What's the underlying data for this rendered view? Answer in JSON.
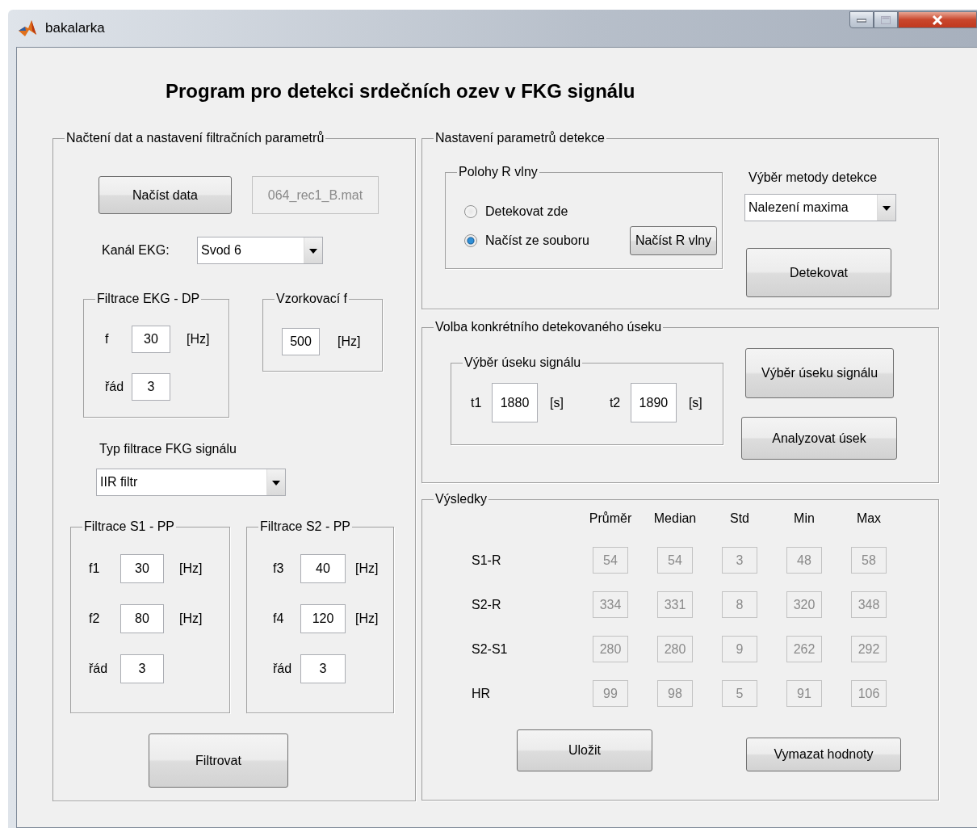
{
  "window": {
    "title": "bakalarka"
  },
  "heading": "Program pro detekci srdečních ozev v FKG signálu",
  "load_panel": {
    "title": "Načtení dat a nastavení filtračních parametrů",
    "load_button": "Načíst data",
    "file_field": {
      "value": "064_rec1_B.mat",
      "disabled": true
    },
    "channel_label": "Kanál EKG:",
    "channel_select": "Svod 6",
    "ekg_filter": {
      "title": "Filtrace EKG - DP",
      "rows": [
        {
          "label": "f",
          "value": "30",
          "unit": "[Hz]"
        },
        {
          "label": "řád",
          "value": "3"
        }
      ]
    },
    "sampling": {
      "title": "Vzorkovací f",
      "value": "500",
      "unit": "[Hz]"
    },
    "filter_type_label": "Typ filtrace FKG signálu",
    "filter_type_select": "IIR filtr",
    "s1_filter": {
      "title": "Filtrace S1 - PP",
      "rows": [
        {
          "label": "f1",
          "value": "30",
          "unit": "[Hz]"
        },
        {
          "label": "f2",
          "value": "80",
          "unit": "[Hz]"
        },
        {
          "label": "řád",
          "value": "3"
        }
      ]
    },
    "s2_filter": {
      "title": "Filtrace S2 - PP",
      "rows": [
        {
          "label": "f3",
          "value": "40",
          "unit": "[Hz]"
        },
        {
          "label": "f4",
          "value": "120",
          "unit": "[Hz]"
        },
        {
          "label": "řád",
          "value": "3"
        }
      ]
    },
    "filter_button": "Filtrovat"
  },
  "detection_panel": {
    "title": "Nastavení parametrů detekce",
    "r_wave": {
      "title": "Polohy R vlny",
      "options": [
        {
          "label": "Detekovat zde",
          "selected": false
        },
        {
          "label": "Načíst ze souboru",
          "selected": true
        }
      ],
      "load_button": "Načíst R vlny"
    },
    "method_label": "Výběr metody detekce",
    "method_select": "Nalezení maxima",
    "detect_button": "Detekovat"
  },
  "segment_panel": {
    "title": "Volba konkrétního detekovaného úseku",
    "range": {
      "title": "Výběr úseku signálu",
      "fields": [
        {
          "label": "t1",
          "value": "1880",
          "unit": "[s]"
        },
        {
          "label": "t2",
          "value": "1890",
          "unit": "[s]"
        }
      ]
    },
    "buttons": [
      "Výběr úseku signálu",
      "Analyzovat úsek"
    ]
  },
  "results_panel": {
    "title": "Výsledky",
    "fields_disabled": true,
    "columns": [
      "Průměr",
      "Median",
      "Std",
      "Min",
      "Max"
    ],
    "rows": [
      {
        "label": "S1-R",
        "values": [
          "54",
          "54",
          "3",
          "48",
          "58"
        ]
      },
      {
        "label": "S2-R",
        "values": [
          "334",
          "331",
          "8",
          "320",
          "348"
        ]
      },
      {
        "label": "S2-S1",
        "values": [
          "280",
          "280",
          "9",
          "262",
          "292"
        ]
      },
      {
        "label": "HR",
        "values": [
          "99",
          "98",
          "5",
          "91",
          "106"
        ]
      }
    ],
    "buttons": [
      "Uložit",
      "Vymazat hodnoty"
    ]
  }
}
